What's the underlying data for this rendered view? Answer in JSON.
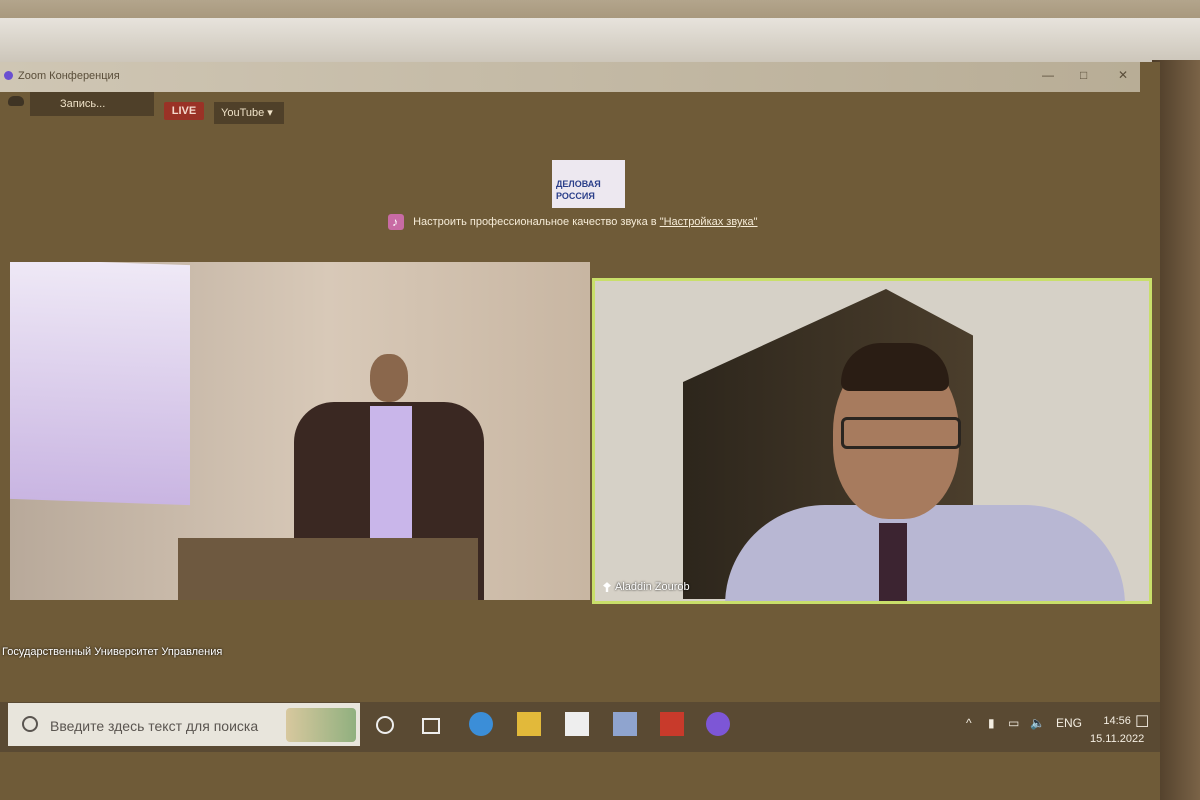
{
  "window": {
    "title": "Zoom Конференция"
  },
  "toolbar": {
    "record_label": "Запись...",
    "live_label": "LIVE",
    "stream_target": "YouTube"
  },
  "logo": {
    "text": "ДЕЛОВАЯ РОССИЯ"
  },
  "notice": {
    "text": "Настроить профессиональное качество звука в ",
    "link": "\"Настройках звука\""
  },
  "participants": [
    {
      "name": "Государственный Университет Управления"
    },
    {
      "name": "Aladdin Zourob"
    }
  ],
  "taskbar": {
    "search_placeholder": "Введите здесь текст для поиска",
    "language": "ENG",
    "time": "14:56",
    "date": "15.11.2022"
  }
}
